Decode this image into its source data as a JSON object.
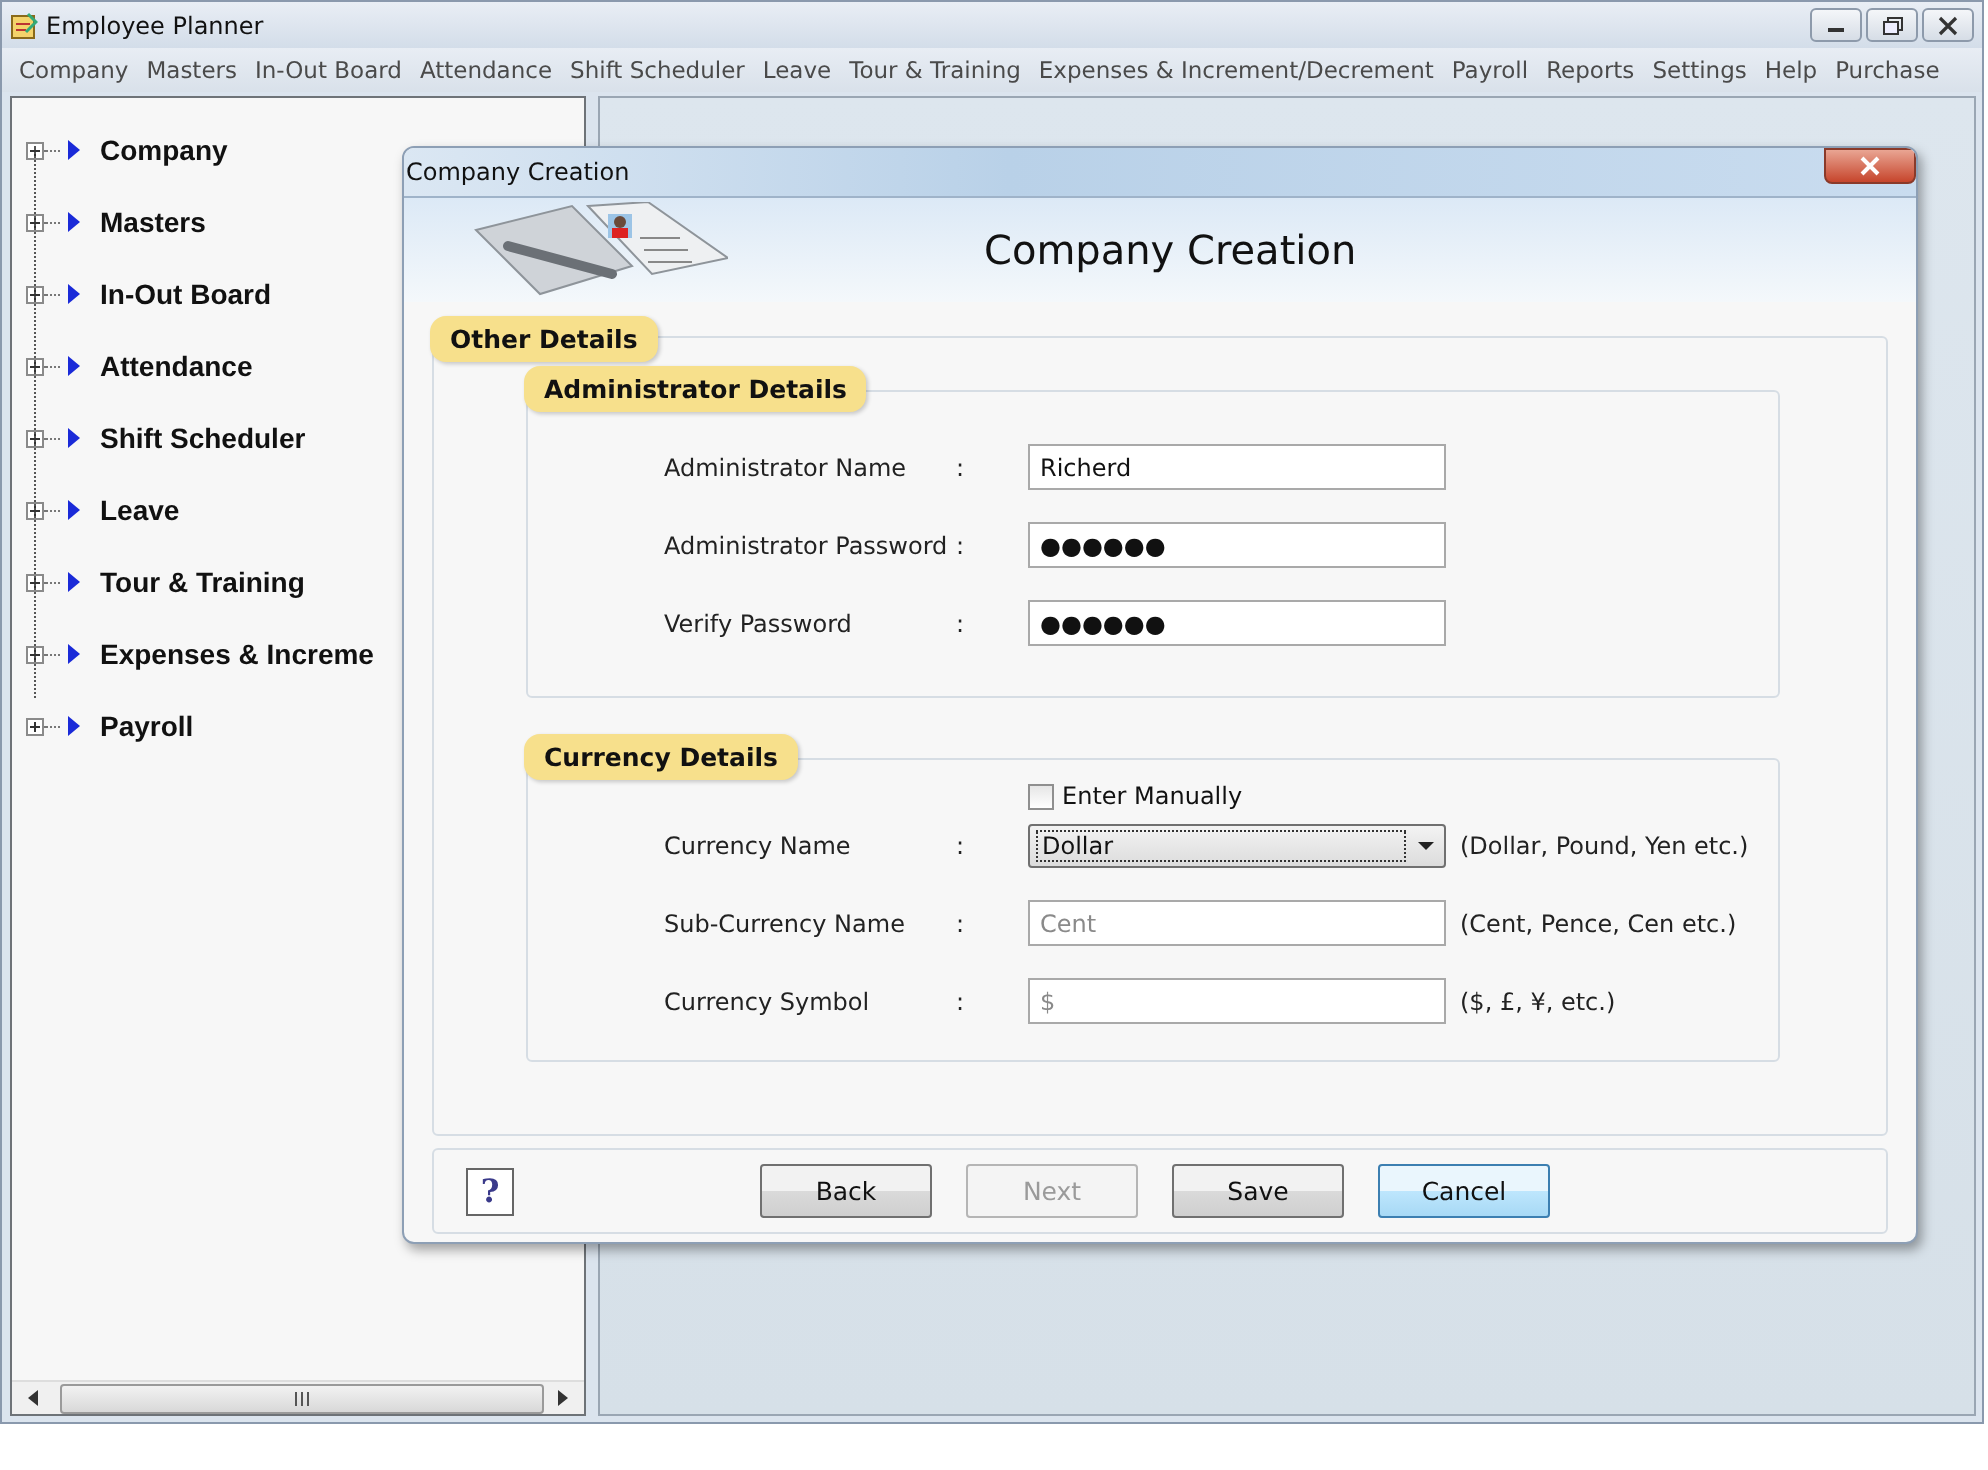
{
  "window": {
    "title": "Employee Planner"
  },
  "menu": [
    "Company",
    "Masters",
    "In-Out Board",
    "Attendance",
    "Shift Scheduler",
    "Leave",
    "Tour & Training",
    "Expenses & Increment/Decrement",
    "Payroll",
    "Reports",
    "Settings",
    "Help",
    "Purchase"
  ],
  "sidebar": {
    "items": [
      {
        "label": "Company",
        "expanded": false
      },
      {
        "label": "Masters",
        "expanded": false
      },
      {
        "label": "In-Out Board",
        "expanded": false
      },
      {
        "label": "Attendance",
        "expanded": false
      },
      {
        "label": "Shift Scheduler",
        "expanded": false
      },
      {
        "label": "Leave",
        "expanded": false
      },
      {
        "label": "Tour & Training",
        "expanded": false
      },
      {
        "label": "Expenses & Increme",
        "expanded": false
      },
      {
        "label": "Payroll",
        "expanded": false
      }
    ]
  },
  "dialog": {
    "title": "Company Creation",
    "heading": "Company Creation",
    "group": "Other Details",
    "sections": [
      {
        "title": "Administrator Details",
        "rows": [
          {
            "kind": "text",
            "label": "Administrator Name",
            "colon": ":",
            "value": "Richerd",
            "disabled": false
          },
          {
            "kind": "text",
            "label": "Administrator Password",
            "colon": ":",
            "value": "●●●●●●",
            "disabled": false
          },
          {
            "kind": "text",
            "label": "Verify Password",
            "colon": ":",
            "value": "●●●●●●",
            "disabled": false
          }
        ]
      },
      {
        "title": "Currency Details",
        "checkbox": {
          "label": "Enter Manually",
          "checked": false
        },
        "rows": [
          {
            "kind": "combo",
            "label": "Currency Name",
            "colon": ":",
            "value": "Dollar",
            "disabled": false,
            "hint": "(Dollar, Pound, Yen etc.)"
          },
          {
            "kind": "text",
            "label": "Sub-Currency Name",
            "colon": ":",
            "value": "Cent",
            "disabled": true,
            "hint": "(Cent, Pence, Cen etc.)"
          },
          {
            "kind": "text",
            "label": "Currency Symbol",
            "colon": ":",
            "value": "$",
            "disabled": true,
            "hint": "($, £, ¥, etc.)"
          }
        ]
      }
    ],
    "help": "?",
    "buttons": [
      {
        "label": "Back",
        "disabled": false,
        "default": false
      },
      {
        "label": "Next",
        "disabled": true,
        "default": false
      },
      {
        "label": "Save",
        "disabled": false,
        "default": false
      },
      {
        "label": "Cancel",
        "disabled": false,
        "default": true
      }
    ]
  }
}
